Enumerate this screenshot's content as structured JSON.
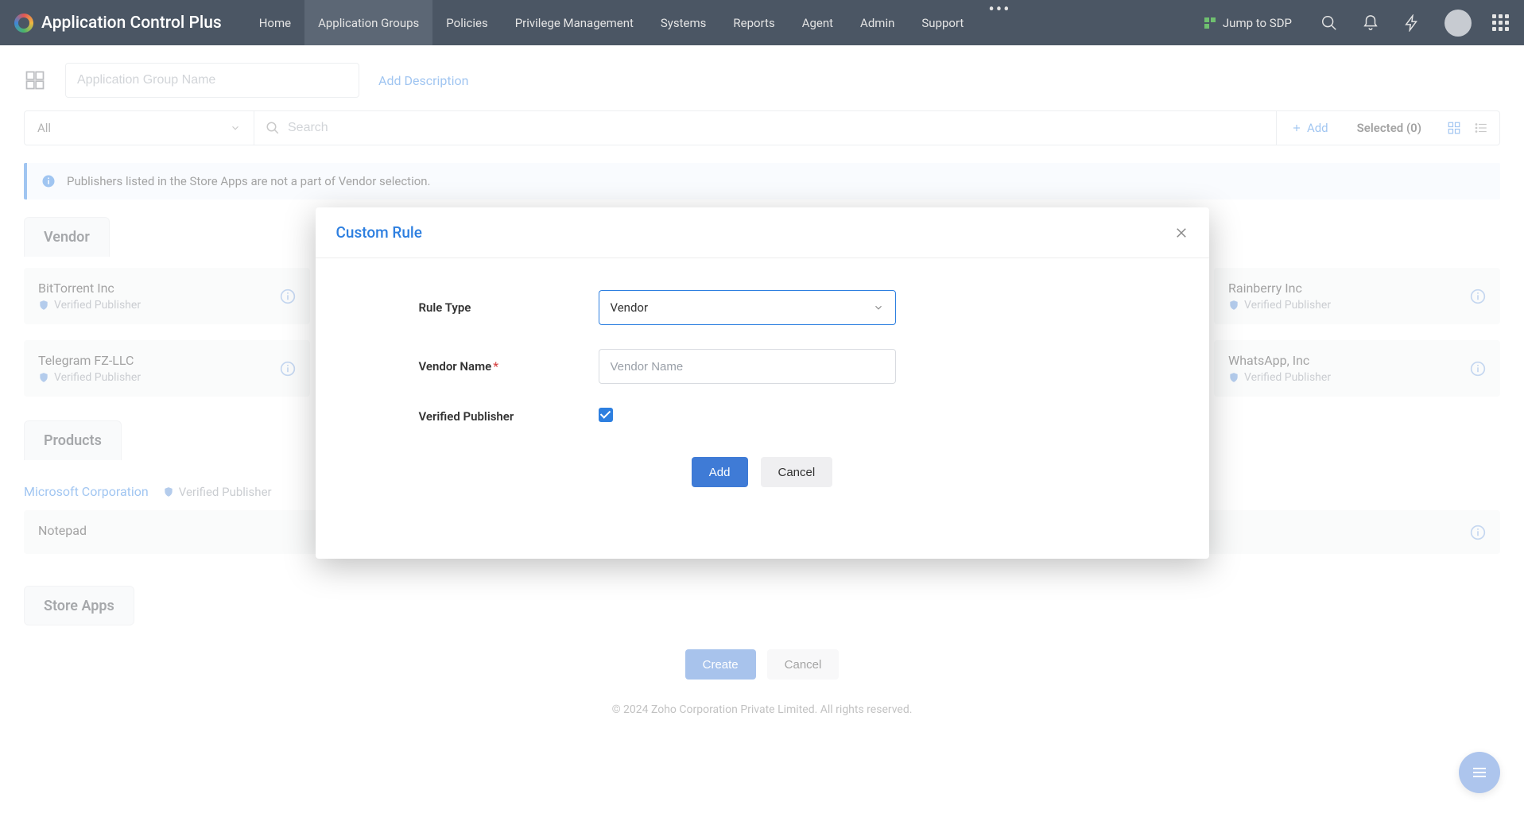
{
  "app": {
    "title": "Application Control Plus"
  },
  "nav": {
    "items": [
      {
        "label": "Home"
      },
      {
        "label": "Application Groups"
      },
      {
        "label": "Policies"
      },
      {
        "label": "Privilege Management"
      },
      {
        "label": "Systems"
      },
      {
        "label": "Reports"
      },
      {
        "label": "Agent"
      },
      {
        "label": "Admin"
      },
      {
        "label": "Support"
      }
    ],
    "active_index": 1,
    "jump_label": "Jump to SDP"
  },
  "group_form": {
    "name_placeholder": "Application Group Name",
    "add_description_label": "Add Description"
  },
  "filter": {
    "dropdown_value": "All",
    "search_placeholder": "Search",
    "add_label": "Add",
    "selected_label": "Selected (0)"
  },
  "info_banner": "Publishers listed in the Store Apps are not a part of Vendor selection.",
  "sections": {
    "vendor_tab": "Vendor",
    "products_tab": "Products",
    "storeapps_tab": "Store Apps",
    "verified_label": "Verified Publisher",
    "vendors_left": [
      {
        "name": "BitTorrent Inc"
      },
      {
        "name": "Telegram FZ-LLC"
      }
    ],
    "vendors_right": [
      {
        "name": "Rainberry Inc"
      },
      {
        "name": "WhatsApp, Inc"
      }
    ],
    "product_publisher": {
      "link": "Microsoft Corporation",
      "badge": "Verified Publisher"
    },
    "product_items": [
      {
        "name": "Notepad"
      }
    ]
  },
  "footer": {
    "create": "Create",
    "cancel": "Cancel",
    "copyright": "© 2024 Zoho Corporation Private Limited. All rights reserved."
  },
  "modal": {
    "title": "Custom Rule",
    "rule_type_label": "Rule Type",
    "rule_type_value": "Vendor",
    "vendor_name_label": "Vendor Name",
    "vendor_name_placeholder": "Vendor Name",
    "verified_publisher_label": "Verified Publisher",
    "add": "Add",
    "cancel": "Cancel"
  }
}
